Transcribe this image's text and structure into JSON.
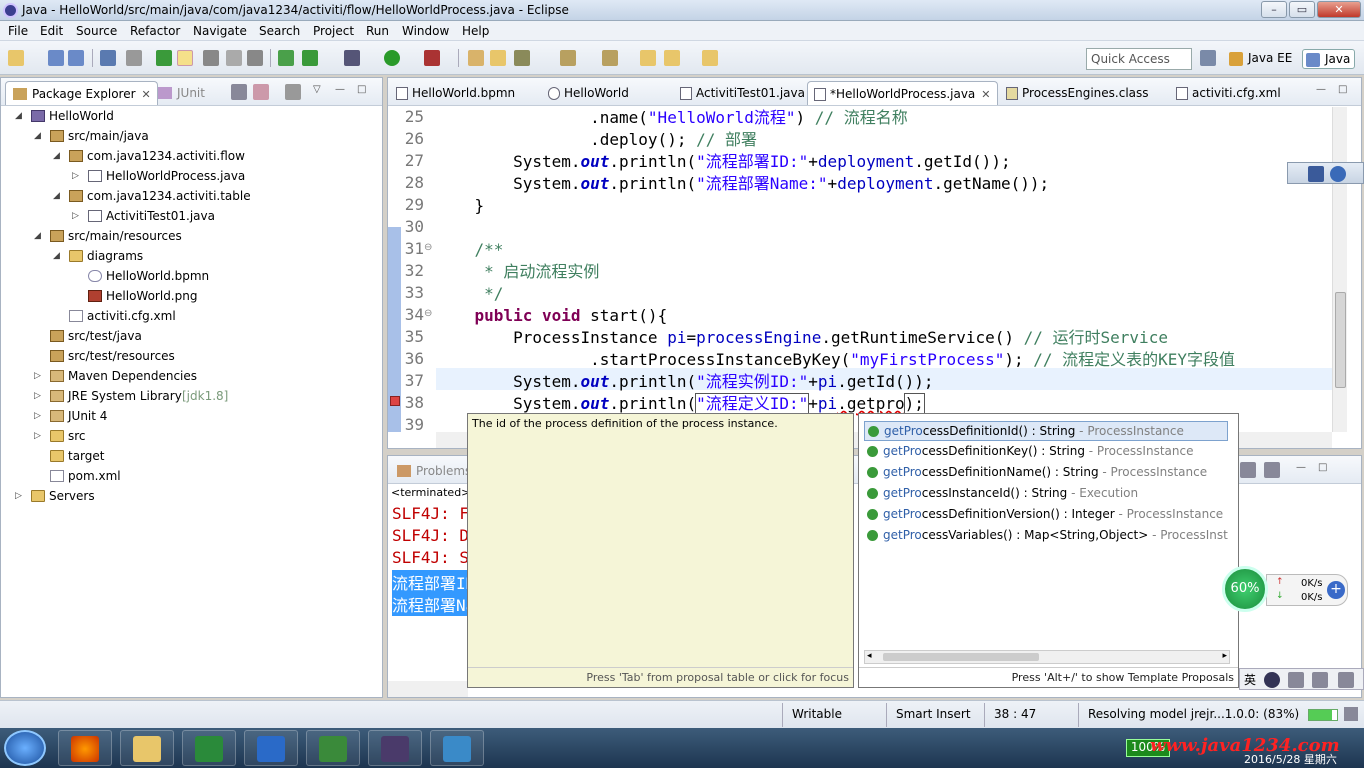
{
  "window": {
    "title": "Java - HelloWorld/src/main/java/com/java1234/activiti/flow/HelloWorldProcess.java - Eclipse",
    "minimize": "–",
    "maximize": "▭",
    "close": "✕"
  },
  "menu": [
    "File",
    "Edit",
    "Source",
    "Refactor",
    "Navigate",
    "Search",
    "Project",
    "Run",
    "Window",
    "Help"
  ],
  "toolbar": {
    "quick_access_placeholder": "Quick Access",
    "perspectives": [
      "Java EE",
      "Java"
    ]
  },
  "left_panel": {
    "tabs": [
      {
        "label": "Package Explorer",
        "close": "✕"
      },
      {
        "label": "JUnit"
      }
    ],
    "tree": [
      {
        "label": "HelloWorld",
        "icon": "project-icon",
        "depth": 0,
        "twisty": "◢"
      },
      {
        "label": "src/main/java",
        "icon": "package-folder-icon",
        "depth": 1,
        "twisty": "◢"
      },
      {
        "label": "com.java1234.activiti.flow",
        "icon": "package-icon",
        "depth": 2,
        "twisty": "◢"
      },
      {
        "label": "HelloWorldProcess.java",
        "icon": "java-file-icon",
        "depth": 3,
        "twisty": "▷"
      },
      {
        "label": "com.java1234.activiti.table",
        "icon": "package-icon",
        "depth": 2,
        "twisty": "◢"
      },
      {
        "label": "ActivitiTest01.java",
        "icon": "java-file-icon",
        "depth": 3,
        "twisty": "▷"
      },
      {
        "label": "src/main/resources",
        "icon": "package-folder-icon",
        "depth": 1,
        "twisty": "◢"
      },
      {
        "label": "diagrams",
        "icon": "folder-icon",
        "depth": 2,
        "twisty": "◢"
      },
      {
        "label": "HelloWorld.bpmn",
        "icon": "bpmn-file-icon",
        "depth": 3,
        "twisty": ""
      },
      {
        "label": "HelloWorld.png",
        "icon": "image-file-icon",
        "depth": 3,
        "twisty": ""
      },
      {
        "label": "activiti.cfg.xml",
        "icon": "xml-file-icon",
        "depth": 2,
        "twisty": ""
      },
      {
        "label": "src/test/java",
        "icon": "package-folder-icon",
        "depth": 1,
        "twisty": ""
      },
      {
        "label": "src/test/resources",
        "icon": "package-folder-icon",
        "depth": 1,
        "twisty": ""
      },
      {
        "label": "Maven Dependencies",
        "icon": "library-icon",
        "depth": 1,
        "twisty": "▷"
      },
      {
        "label": "JRE System Library",
        "suffix": "[jdk1.8]",
        "icon": "library-icon",
        "depth": 1,
        "twisty": "▷"
      },
      {
        "label": "JUnit 4",
        "icon": "library-icon",
        "depth": 1,
        "twisty": "▷"
      },
      {
        "label": "src",
        "icon": "folder-icon",
        "depth": 1,
        "twisty": "▷"
      },
      {
        "label": "target",
        "icon": "folder-icon",
        "depth": 1,
        "twisty": ""
      },
      {
        "label": "pom.xml",
        "icon": "xml-file-icon",
        "depth": 1,
        "twisty": ""
      },
      {
        "label": "Servers",
        "icon": "folder-icon",
        "depth": 0,
        "twisty": "▷"
      }
    ]
  },
  "editor": {
    "tabs": [
      {
        "label": "HelloWorld.bpmn"
      },
      {
        "label": "HelloWorld"
      },
      {
        "label": "ActivitiTest01.java"
      },
      {
        "label": "*HelloWorldProcess.java",
        "close": "✕",
        "active": true
      },
      {
        "label": "ProcessEngines.class"
      },
      {
        "label": "activiti.cfg.xml"
      }
    ],
    "line_numbers": [
      "25",
      "26",
      "27",
      "28",
      "29",
      "30",
      "31",
      "32",
      "33",
      "34",
      "35",
      "36",
      "37",
      "38",
      "39"
    ],
    "code": {
      "l25_a": "                .name(",
      "l25_s": "\"HelloWorld流程\"",
      "l25_b": ") ",
      "l25_c": "// 流程名称",
      "l26_a": "                .deploy(); ",
      "l26_c": "// 部署",
      "l27_a": "        System.",
      "l27_f": "out",
      "l27_b": ".println(",
      "l27_s": "\"流程部署ID:\"",
      "l27_d": "+",
      "l27_v": "deployment",
      "l27_e": ".getId());",
      "l28_a": "        System.",
      "l28_f": "out",
      "l28_b": ".println(",
      "l28_s": "\"流程部署Name:\"",
      "l28_d": "+",
      "l28_v": "deployment",
      "l28_e": ".getName());",
      "l29": "    }",
      "l30": "",
      "l31": "    /**",
      "l32": "     * 启动流程实例",
      "l33": "     */",
      "l34_k1": "public",
      "l34_k2": "void",
      "l34_e": " start(){",
      "l35_a": "        ProcessInstance ",
      "l35_v": "pi",
      "l35_b": "=",
      "l35_v2": "processEngine",
      "l35_e": ".getRuntimeService() ",
      "l35_c": "// 运行时Service",
      "l36_a": "                .startProcessInstanceByKey(",
      "l36_s": "\"myFirstProcess\"",
      "l36_b": "); ",
      "l36_c": "// 流程定义表的KEY字段值",
      "l37_a": "        System.",
      "l37_f": "out",
      "l37_b": ".println(",
      "l37_s": "\"流程实例ID:\"",
      "l37_d": "+",
      "l37_v": "pi",
      "l37_e": ".getId());",
      "l38_a": "        System.",
      "l38_f": "out",
      "l38_b": ".println(",
      "l38_s": "\"流程定义ID:\"",
      "l38_d": "+",
      "l38_v": "pi",
      "l38_e": ".getpro",
      "l38_z": ");"
    }
  },
  "bottom_panel": {
    "tab": "Problems",
    "terminated": "<terminated>",
    "console_lines": [
      "SLF4J: F",
      "SLF4J: D",
      "SLF4J: S",
      "流程部署ID",
      "流程部署Na"
    ]
  },
  "content_assist": {
    "doc": "The id of the process definition of the process instance.",
    "doc_footer": "Press 'Tab' from proposal table or click for focus",
    "proposals": [
      {
        "pre": "getPro",
        "rest": "cessDefinitionId() : String",
        "type": " - ProcessInstance",
        "selected": true
      },
      {
        "pre": "getPro",
        "rest": "cessDefinitionKey() : String",
        "type": " - ProcessInstance"
      },
      {
        "pre": "getPro",
        "rest": "cessDefinitionName() : String",
        "type": " - ProcessInstance"
      },
      {
        "pre": "getPro",
        "rest": "cessInstanceId() : String",
        "type": " - Execution"
      },
      {
        "pre": "getPro",
        "rest": "cessDefinitionVersion() : Integer",
        "type": " - ProcessInstance"
      },
      {
        "pre": "getPro",
        "rest": "cessVariables() : Map<String,Object>",
        "type": " - ProcessInstan"
      }
    ],
    "footer": "Press 'Alt+/' to show Template Proposals"
  },
  "statusbar": {
    "writable": "Writable",
    "insert_mode": "Smart Insert",
    "position": "38 : 47",
    "progress": "Resolving model jrejr...1.0.0: (83%)"
  },
  "speed_widget": {
    "percent": "60%",
    "up": "0K/s",
    "down": "0K/s"
  },
  "input_method": "英",
  "taskbar": {
    "battery": "100%",
    "watermark": "www.java1234.com",
    "date": "2016/5/28 星期六"
  }
}
